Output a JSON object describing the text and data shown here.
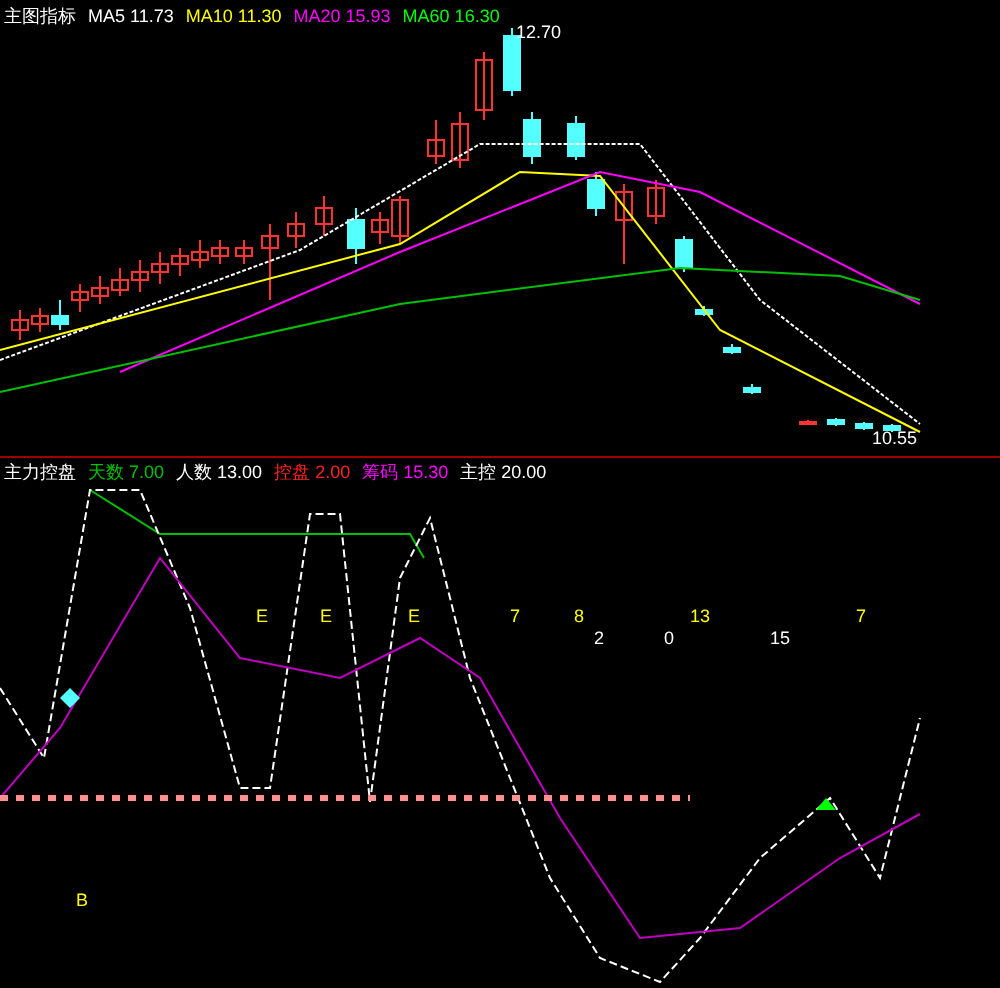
{
  "price_panel": {
    "title": "主图指标",
    "indicators": [
      {
        "label": "MA5 11.73",
        "color": "#ffffff"
      },
      {
        "label": "MA10 11.30",
        "color": "#ffff00"
      },
      {
        "label": "MA20 15.93",
        "color": "#ff00ff"
      },
      {
        "label": "MA60 16.30",
        "color": "#00ff00"
      }
    ],
    "high_label": "12.70",
    "low_label": "10.55"
  },
  "indicator_panel": {
    "title": "主力控盘",
    "indicators": [
      {
        "label": "天数 7.00",
        "color": "#00c000"
      },
      {
        "label": "人数 13.00",
        "color": "#ffffff"
      },
      {
        "label": "控盘 2.00",
        "color": "#ff2020"
      },
      {
        "label": "筹码 15.30",
        "color": "#ff00ff"
      },
      {
        "label": "主控 20.00",
        "color": "#ffffff"
      }
    ],
    "marks": [
      {
        "text": "E",
        "color": "#ffff00"
      },
      {
        "text": "E",
        "color": "#ffff00"
      },
      {
        "text": "E",
        "color": "#ffff00"
      },
      {
        "text": "7",
        "color": "#ffff00"
      },
      {
        "text": "8",
        "color": "#ffff00"
      },
      {
        "text": "13",
        "color": "#ffff00"
      },
      {
        "text": "7",
        "color": "#ffff00"
      },
      {
        "text": "2",
        "color": "#ffffff"
      },
      {
        "text": "0",
        "color": "#ffffff"
      },
      {
        "text": "15",
        "color": "#ffffff"
      },
      {
        "text": "B",
        "color": "#ffff00"
      }
    ]
  }
}
